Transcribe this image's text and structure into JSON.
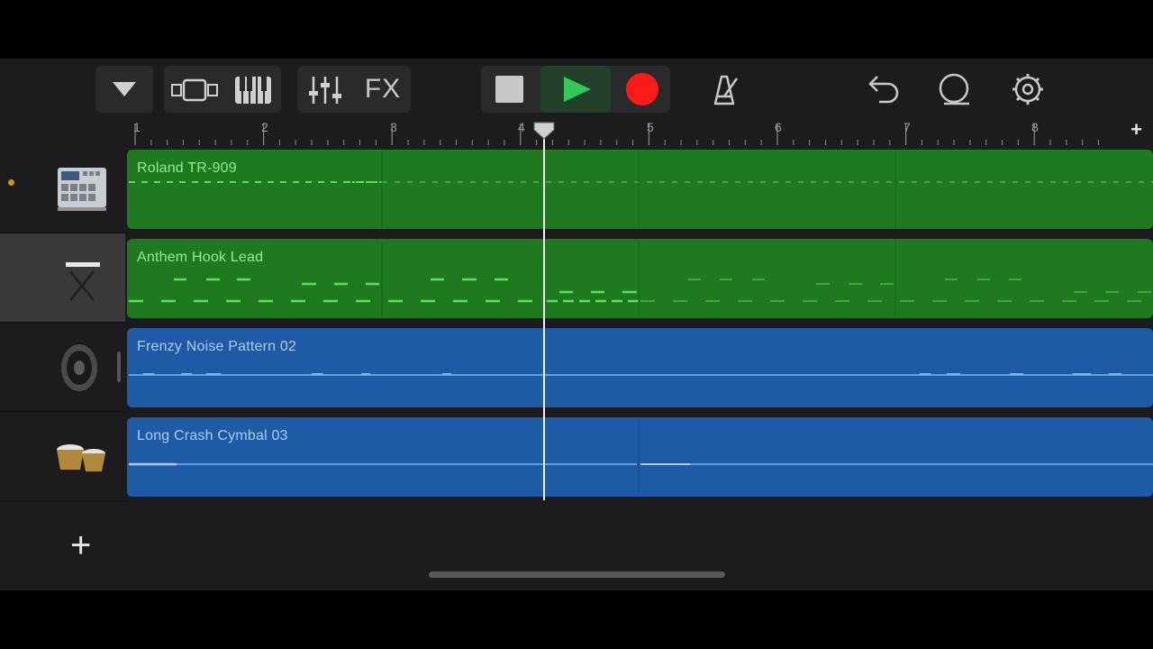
{
  "toolbar": {
    "fx_label": "FX",
    "icons": [
      "tracks-menu-icon",
      "track-view-icon",
      "keyboard-icon",
      "mixer-icon",
      "fx",
      "stop-icon",
      "play-icon",
      "record-icon",
      "metronome-icon",
      "undo-icon",
      "loop-browser-icon",
      "settings-icon"
    ]
  },
  "ruler": {
    "bars": [
      "1",
      "2",
      "3",
      "4",
      "5",
      "6",
      "7",
      "8"
    ],
    "add_label": "+"
  },
  "tracks": [
    {
      "name": "Roland TR-909",
      "instrument": "drum-machine-icon",
      "color": "#1f7a1f",
      "selected": false,
      "active_dot": true
    },
    {
      "name": "Anthem Hook Lead",
      "instrument": "keyboard-stand-icon",
      "color": "#1f7a1f",
      "selected": true,
      "active_dot": false
    },
    {
      "name": "Frenzy Noise Pattern 02",
      "instrument": "speaker-icon",
      "color": "#1e5aa6",
      "selected": false,
      "active_dot": false
    },
    {
      "name": "Long Crash Cymbal 03",
      "instrument": "bongos-icon",
      "color": "#1e5aa6",
      "selected": false,
      "active_dot": false
    }
  ],
  "add_track_label": "+",
  "colors": {
    "green_region": "#1f7a1f",
    "blue_region": "#1e5aa6",
    "record": "#ff1a1a",
    "play": "#34c759"
  }
}
